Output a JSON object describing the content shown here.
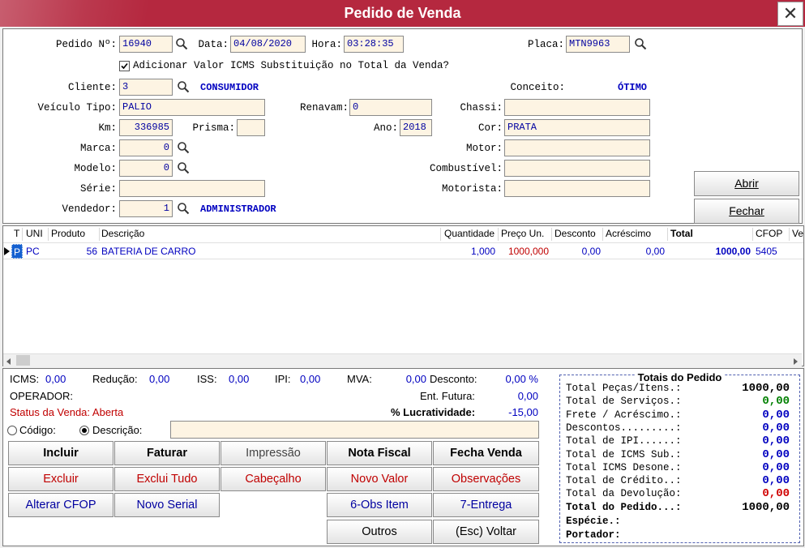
{
  "window": {
    "title": "Pedido de Venda",
    "close": "✕"
  },
  "header": {
    "pedido_label": "Pedido Nº:",
    "pedido_value": "16940",
    "data_label": "Data:",
    "data_value": "04/08/2020",
    "hora_label": "Hora:",
    "hora_value": "03:28:35",
    "placa_label": "Placa:",
    "placa_value": "MTN9963",
    "icms_checkbox_label": "Adicionar Valor ICMS Substituição no Total da Venda?",
    "cliente_label": "Cliente:",
    "cliente_value": "3",
    "cliente_name": "CONSUMIDOR",
    "conceito_label": "Conceito:",
    "conceito_value": "ÓTIMO",
    "veiculo_label": "Veículo Tipo:",
    "veiculo_value": "PALIO",
    "renavam_label": "Renavam:",
    "renavam_value": "0",
    "chassi_label": "Chassi:",
    "chassi_value": "",
    "km_label": "Km:",
    "km_value": "336985",
    "prisma_label": "Prisma:",
    "prisma_value": "",
    "ano_label": "Ano:",
    "ano_value": "2018",
    "cor_label": "Cor:",
    "cor_value": "PRATA",
    "marca_label": "Marca:",
    "marca_value": "0",
    "motor_label": "Motor:",
    "motor_value": "",
    "modelo_label": "Modelo:",
    "modelo_value": "0",
    "combustivel_label": "Combustível:",
    "combustivel_value": "",
    "serie_label": "Série:",
    "serie_value": "",
    "motorista_label": "Motorista:",
    "motorista_value": "",
    "vendedor_label": "Vendedor:",
    "vendedor_value": "1",
    "vendedor_name": "ADMINISTRADOR",
    "abrir_button": "Abrir",
    "fechar_button": "Fechar"
  },
  "grid": {
    "columns": [
      "T",
      "UNI",
      "Produto",
      "Descrição",
      "Quantidade",
      "Preço Un.",
      "Desconto",
      "Acréscimo",
      "Total",
      "CFOP",
      "Ve"
    ],
    "rows": [
      {
        "t": "P",
        "uni": "PC",
        "produto": "56",
        "descricao": "BATERIA DE CARRO",
        "quantidade": "1,000",
        "preco": "1000,000",
        "desconto": "0,00",
        "acrescimo": "0,00",
        "total": "1000,00",
        "cfop": "5405"
      }
    ]
  },
  "summary": {
    "icms_label": "ICMS:",
    "icms_value": "0,00",
    "reducao_label": "Redução:",
    "reducao_value": "0,00",
    "iss_label": "ISS:",
    "iss_value": "0,00",
    "ipi_label": "IPI:",
    "ipi_value": "0,00",
    "mva_label": "MVA:",
    "mva_value": "0,00",
    "desconto_label": "Desconto:",
    "desconto_value": "0,00 %",
    "operador_label": "OPERADOR:",
    "ent_futura_label": "Ent. Futura:",
    "ent_futura_value": "0,00",
    "status_label": "Status da Venda: Aberta",
    "lucratividade_label": "% Lucratividade:",
    "lucratividade_value": "-15,00",
    "codigo_radio": "Código:",
    "descricao_radio": "Descrição:",
    "search_value": ""
  },
  "buttons": {
    "incluir": "Incluir",
    "faturar": "Faturar",
    "impressao": "Impressão",
    "nota_fiscal": "Nota Fiscal",
    "fecha_venda": "Fecha Venda",
    "excluir": "Excluir",
    "exclui_tudo": "Exclui Tudo",
    "cabecalho": "Cabeçalho",
    "novo_valor": "Novo Valor",
    "observacoes": "Observações",
    "alterar_cfop": "Alterar CFOP",
    "novo_serial": "Novo Serial",
    "obs_item": "6-Obs Item",
    "entrega": "7-Entrega",
    "outros": "Outros",
    "voltar": "(Esc) Voltar"
  },
  "totals": {
    "title": "Totais do Pedido",
    "items": [
      {
        "label": "Total Peças/Itens.:",
        "value": "1000,00",
        "color": "#000000"
      },
      {
        "label": "Total de Serviços.:",
        "value": "0,00",
        "color": "#008000"
      },
      {
        "label": "Frete / Acréscimo.:",
        "value": "0,00",
        "color": "#0000c0"
      },
      {
        "label": "Descontos.........:",
        "value": "0,00",
        "color": "#0000c0"
      },
      {
        "label": "Total de IPI......:",
        "value": "0,00",
        "color": "#0000c0"
      },
      {
        "label": "Total de ICMS Sub.:",
        "value": "0,00",
        "color": "#0000c0"
      },
      {
        "label": "Total ICMS Desone.:",
        "value": "0,00",
        "color": "#0000c0"
      },
      {
        "label": "Total de Crédito..:",
        "value": "0,00",
        "color": "#0000c0"
      },
      {
        "label": "Total da Devolução:",
        "value": "0,00",
        "color": "#d00000"
      },
      {
        "label": "Total do Pedido...:",
        "value": "1000,00",
        "color": "#000000"
      }
    ],
    "especie_label": "Espécie.:",
    "portador_label": "Portador:"
  },
  "colors": {
    "titlebar": "#b5283f",
    "input_bg": "#fdf4e3",
    "blue_text": "#0000c0",
    "red_text": "#c00000"
  }
}
